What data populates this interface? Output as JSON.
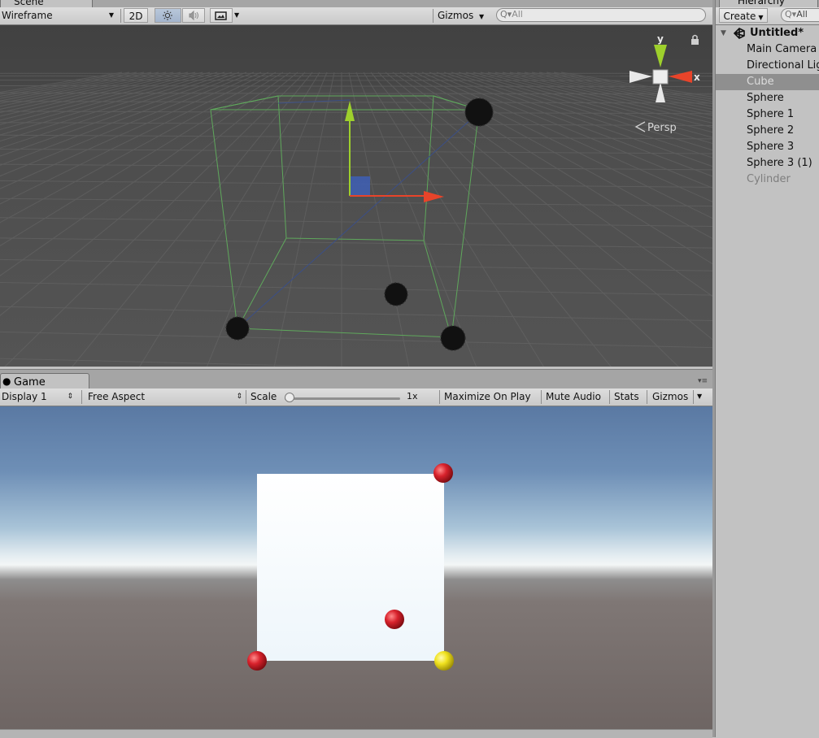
{
  "scene": {
    "tab_label": "Scene",
    "shading_mode": "Wireframe",
    "toggle_2d": "2D",
    "gizmos_label": "Gizmos",
    "search_placeholder": "All",
    "projection_label": "Persp",
    "gizmo_axis_y": "y",
    "gizmo_axis_x": "x"
  },
  "game": {
    "tab_label": "Game",
    "display": "Display 1",
    "aspect": "Free Aspect",
    "scale_label": "Scale",
    "scale_value": "1x",
    "scale_slider_fraction": 0,
    "buttons": [
      "Maximize On Play",
      "Mute Audio",
      "Stats",
      "Gizmos"
    ]
  },
  "hierarchy": {
    "tab_label": "Hierarchy",
    "create_label": "Create",
    "search_placeholder": "All",
    "scene_name": "Untitled*",
    "items": [
      {
        "label": "Main Camera",
        "state": "normal"
      },
      {
        "label": "Directional Light",
        "state": "normal"
      },
      {
        "label": "Cube",
        "state": "selected"
      },
      {
        "label": "Sphere",
        "state": "normal"
      },
      {
        "label": "Sphere 1",
        "state": "normal"
      },
      {
        "label": "Sphere 2",
        "state": "normal"
      },
      {
        "label": "Sphere 3",
        "state": "normal"
      },
      {
        "label": "Sphere 3 (1)",
        "state": "normal"
      },
      {
        "label": "Cylinder",
        "state": "inactive"
      }
    ]
  },
  "colors": {
    "axis_x": "#e8442a",
    "axis_y": "#9ed02c",
    "axis_z": "#3e5fb5",
    "selection_wire": "#5fa85c",
    "sphere_red": "#d8222c",
    "sphere_yellow": "#f0e21e"
  }
}
